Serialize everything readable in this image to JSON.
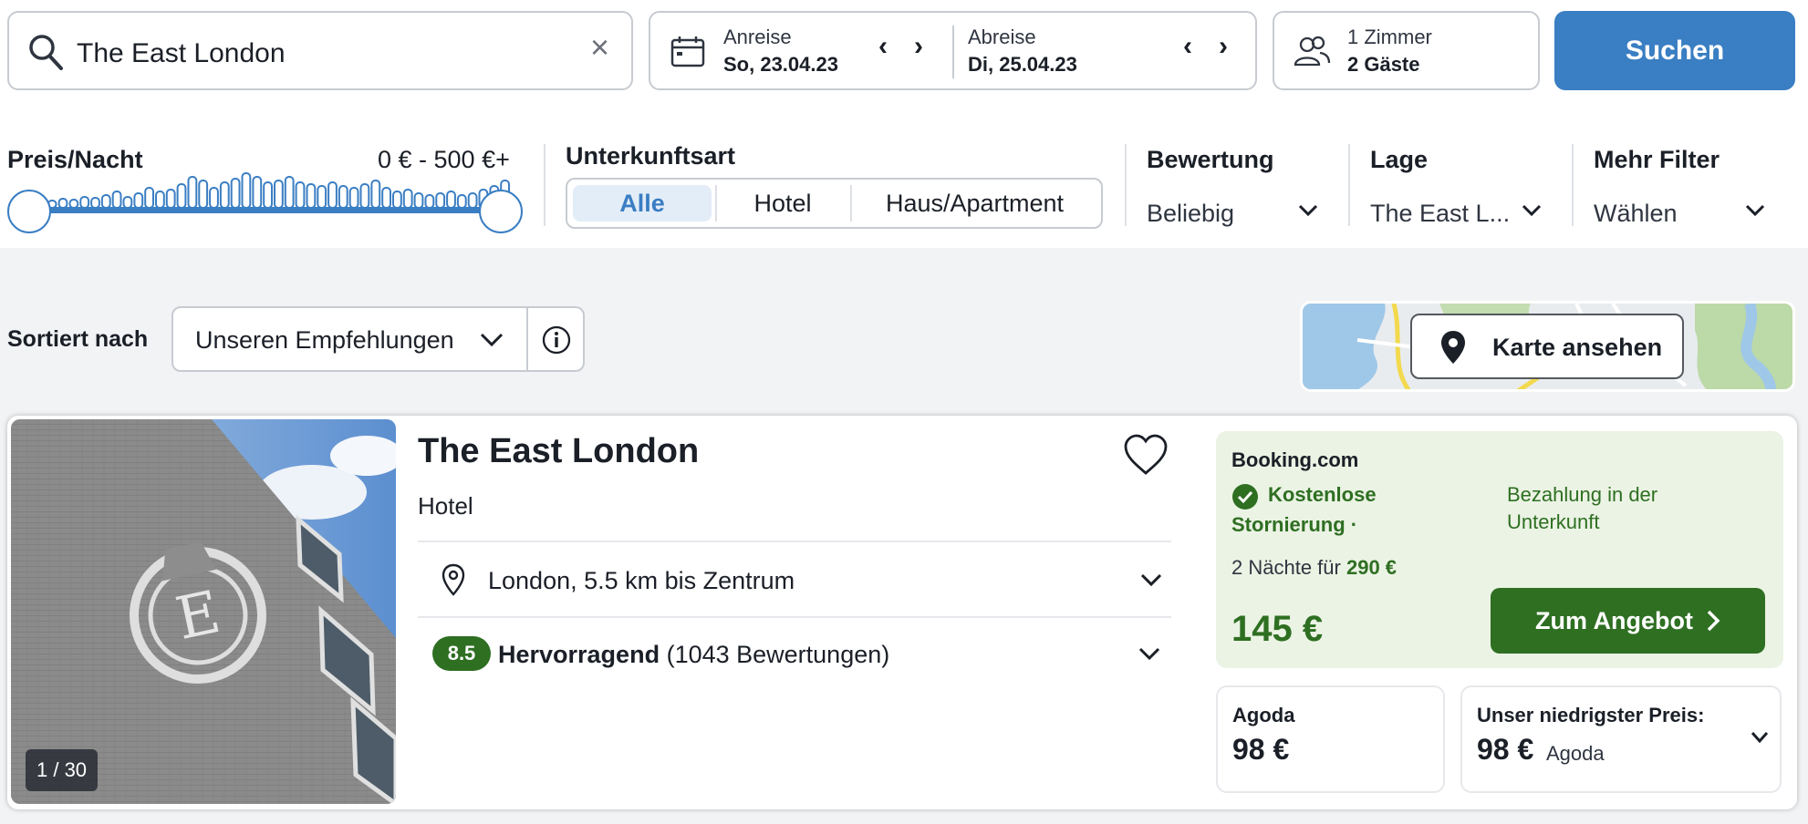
{
  "search": {
    "query": "The East London"
  },
  "dates": {
    "checkin_label": "Anreise",
    "checkin_value": "So, 23.04.23",
    "checkout_label": "Abreise",
    "checkout_value": "Di, 25.04.23"
  },
  "guests": {
    "rooms": "1 Zimmer",
    "guests": "2 Gäste"
  },
  "search_button": "Suchen",
  "filters": {
    "price_title": "Preis/Nacht",
    "price_range": "0 € - 500 €+",
    "price_min_fraction": 0.0,
    "price_max_fraction": 1.0,
    "type_title": "Unterkunftsart",
    "type_options": [
      "Alle",
      "Hotel",
      "Haus/Apartment"
    ],
    "type_selected": "Alle",
    "rating_title": "Bewertung",
    "rating_value": "Beliebig",
    "location_title": "Lage",
    "location_value": "The East L...",
    "more_title": "Mehr Filter",
    "more_value": "Wählen"
  },
  "sort": {
    "label": "Sortiert nach",
    "value": "Unseren Empfehlungen"
  },
  "map": {
    "button_label": "Karte ansehen"
  },
  "hotel": {
    "name": "The East London",
    "type": "Hotel",
    "location": "London, 5.5 km bis Zentrum",
    "rating_score": "8.5",
    "rating_word": "Hervorragend",
    "rating_count": "(1043 Bewertungen)",
    "photo_counter": "1 / 30",
    "offer": {
      "provider": "Booking.com",
      "cancellation_line1": "Kostenlose",
      "cancellation_line2": "Stornierung ·",
      "payment_line1": "Bezahlung in der",
      "payment_line2": "Unterkunft",
      "nights_text": "2 Nächte für",
      "total_price": "290 €",
      "nightly_price": "145 €",
      "cta": "Zum Angebot"
    },
    "alt_offer": {
      "provider": "Agoda",
      "price": "98 €"
    },
    "lowest": {
      "label": "Unser niedrigster Preis:",
      "price": "98 €",
      "provider": "Agoda"
    }
  },
  "colors": {
    "brand_blue": "#3a7ec3",
    "offer_green": "#2e6f22",
    "offer_bg": "#ebf3e4"
  }
}
